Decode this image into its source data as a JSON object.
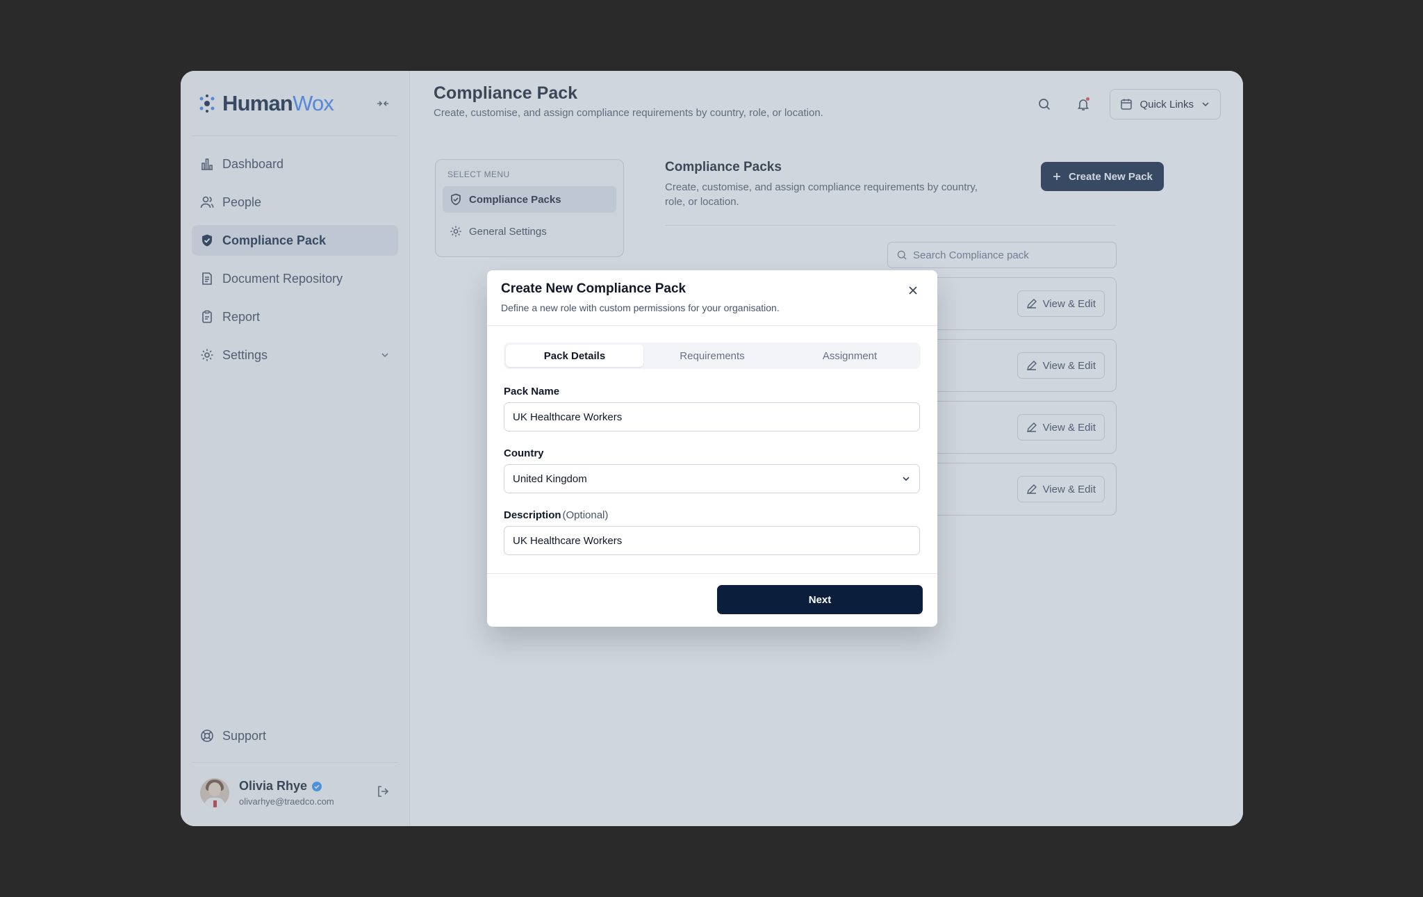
{
  "sidebar": {
    "logo": {
      "part1": "Human",
      "part2": "Wox"
    },
    "items": [
      {
        "label": "Dashboard",
        "icon": "bar-chart-icon"
      },
      {
        "label": "People",
        "icon": "users-icon"
      },
      {
        "label": "Compliance Pack",
        "icon": "shield-check-icon"
      },
      {
        "label": "Document Repository",
        "icon": "document-icon"
      },
      {
        "label": "Report",
        "icon": "clipboard-icon"
      },
      {
        "label": "Settings",
        "icon": "gear-icon"
      }
    ],
    "support_label": "Support",
    "user": {
      "name": "Olivia Rhye",
      "email": "olivarhye@traedco.com"
    }
  },
  "header": {
    "title": "Compliance Pack",
    "subtitle": "Create, customise, and assign compliance requirements by country, role, or location.",
    "quick_links": "Quick Links"
  },
  "select_menu": {
    "label": "SELECT MENU",
    "items": [
      "Compliance Packs",
      "General Settings"
    ]
  },
  "packs": {
    "title": "Compliance Packs",
    "subtitle": "Create, customise, and assign compliance requirements by country, role, or location.",
    "create_label": "Create New Pack",
    "search_placeholder": "Search Compliance pack",
    "view_edit_label": "View & Edit"
  },
  "modal": {
    "title": "Create New Compliance Pack",
    "subtitle": "Define a new role with custom permissions for your organisation.",
    "tabs": [
      "Pack Details",
      "Requirements",
      "Assignment"
    ],
    "pack_name_label": "Pack Name",
    "pack_name_value": "UK Healthcare Workers",
    "country_label": "Country",
    "country_value": "United Kingdom",
    "description_label": "Description",
    "description_optional": "(Optional)",
    "description_value": "UK Healthcare Workers",
    "next_label": "Next"
  },
  "colors": {
    "primary": "#0b1e3b",
    "accent": "#3b82f6",
    "verified": "#2e90fa"
  }
}
